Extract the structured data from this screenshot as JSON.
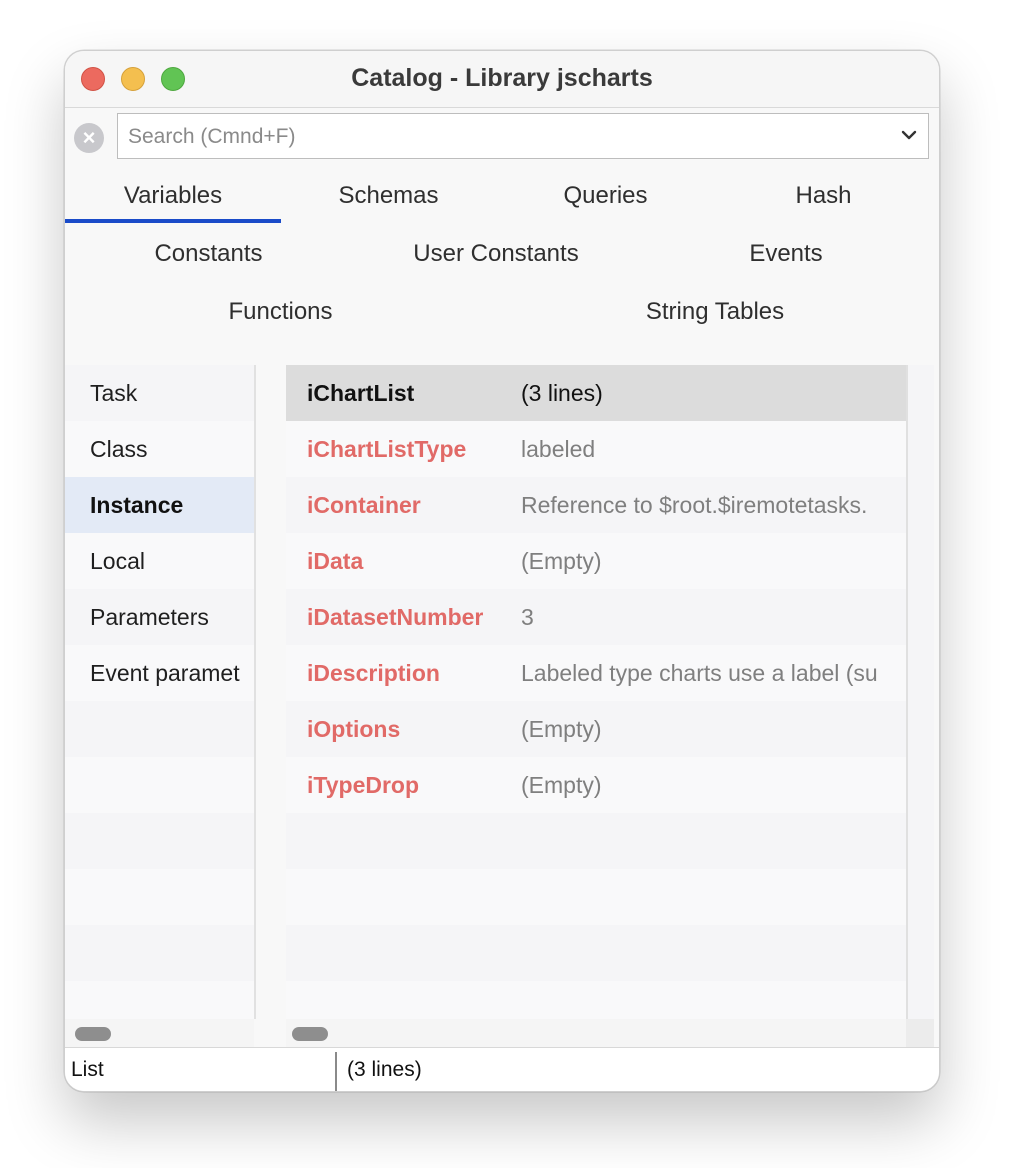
{
  "window": {
    "title": "Catalog - Library jscharts"
  },
  "search": {
    "placeholder": "Search (Cmnd+F)"
  },
  "tabs": [
    "Variables",
    "Schemas",
    "Queries",
    "Hash",
    "Constants",
    "User Constants",
    "Events",
    "Functions",
    "String Tables"
  ],
  "selected_tab": "Variables",
  "left_list": {
    "items": [
      "Task",
      "Class",
      "Instance",
      "Local",
      "Parameters",
      "Event paramet"
    ],
    "selected": "Instance"
  },
  "right_list": {
    "rows": [
      {
        "name": "iChartList",
        "value": "(3 lines)"
      },
      {
        "name": "iChartListType",
        "value": "labeled"
      },
      {
        "name": "iContainer",
        "value": "Reference to $root.$iremotetasks."
      },
      {
        "name": "iData",
        "value": "(Empty)"
      },
      {
        "name": "iDatasetNumber",
        "value": "3"
      },
      {
        "name": "iDescription",
        "value": "Labeled type charts use a label (su"
      },
      {
        "name": "iOptions",
        "value": "(Empty)"
      },
      {
        "name": "iTypeDrop",
        "value": "(Empty)"
      }
    ],
    "selected": "iChartList"
  },
  "status": {
    "left": "List",
    "right": "(3 lines)"
  },
  "colors": {
    "tab_underline": "#1a4bc9",
    "variable_name": "#e16a67",
    "selection": "#e3eaf6",
    "header_row": "#dcdcdc"
  }
}
